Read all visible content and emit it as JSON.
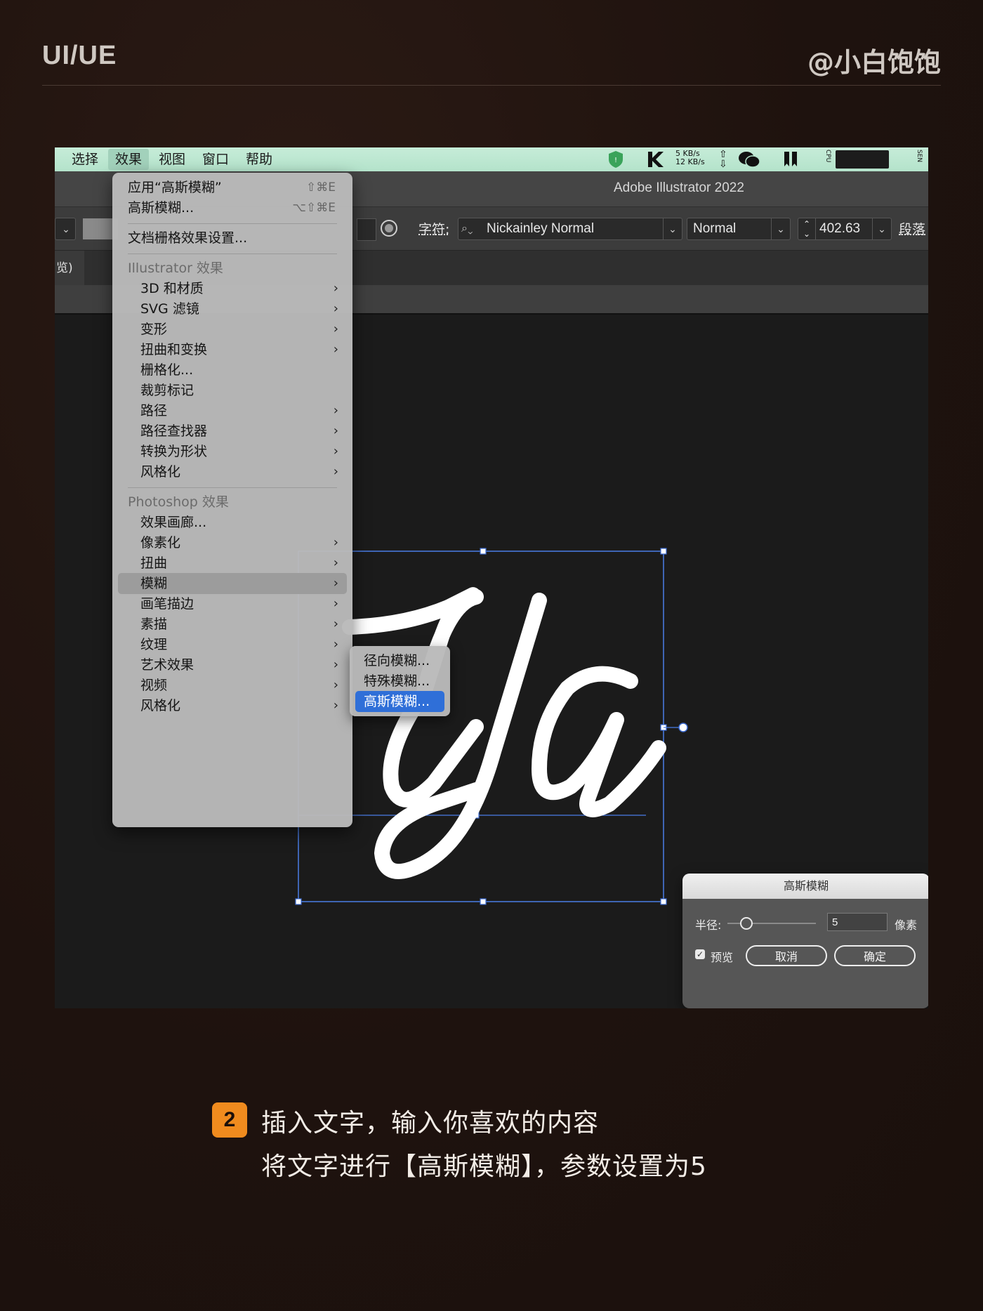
{
  "header": {
    "brand": "UI/UE",
    "author": "@小白饱饱"
  },
  "menubar": {
    "items": [
      "选择",
      "效果",
      "视图",
      "窗口",
      "帮助"
    ],
    "active": "效果",
    "tray": {
      "net_up": "5 KB/s",
      "net_down": "12 KB/s",
      "cpu_label": "CPU",
      "lang": "SEN"
    }
  },
  "app": {
    "title": "Adobe Illustrator 2022"
  },
  "controlbar": {
    "char_label": "字符:",
    "font_name": "Nickainley Normal",
    "font_style": "Normal",
    "font_size": "402.63",
    "para_label": "段落"
  },
  "tabbar": {
    "partial_tab": "览)"
  },
  "effect_menu": {
    "apply_last": {
      "label": "应用“高斯模糊”",
      "shortcut": "⇧⌘E"
    },
    "last_effect": {
      "label": "高斯模糊...",
      "shortcut": "⌥⇧⌘E"
    },
    "doc_raster": "文档栅格效果设置...",
    "illustrator_header": "Illustrator 效果",
    "illustrator_items": [
      "3D 和材质",
      "SVG 滤镜",
      "变形",
      "扭曲和变换",
      "栅格化...",
      "裁剪标记",
      "路径",
      "路径查找器",
      "转换为形状",
      "风格化"
    ],
    "photoshop_header": "Photoshop 效果",
    "photoshop_items": [
      "效果画廊...",
      "像素化",
      "扭曲",
      "模糊",
      "画笔描边",
      "素描",
      "纹理",
      "艺术效果",
      "视频",
      "风格化"
    ],
    "highlighted": "模糊"
  },
  "blur_submenu": {
    "items": [
      "径向模糊...",
      "特殊模糊...",
      "高斯模糊..."
    ],
    "selected": "高斯模糊..."
  },
  "canvas": {
    "text": "Ya"
  },
  "gaussian_dialog": {
    "title": "高斯模糊",
    "radius_label": "半径:",
    "radius_value": "5",
    "unit": "像素",
    "preview_label": "预览",
    "preview_checked": true,
    "cancel": "取消",
    "ok": "确定"
  },
  "caption": {
    "step": "2",
    "line1": "插入文字，输入你喜欢的内容",
    "line2": "将文字进行【高斯模糊】，参数设置为5"
  },
  "colors": {
    "accent_orange": "#f08b1e",
    "menubar_green": "#b4e3cb",
    "selection_blue": "#2f6fd8",
    "bounding_box_blue": "#4a7ee8"
  }
}
